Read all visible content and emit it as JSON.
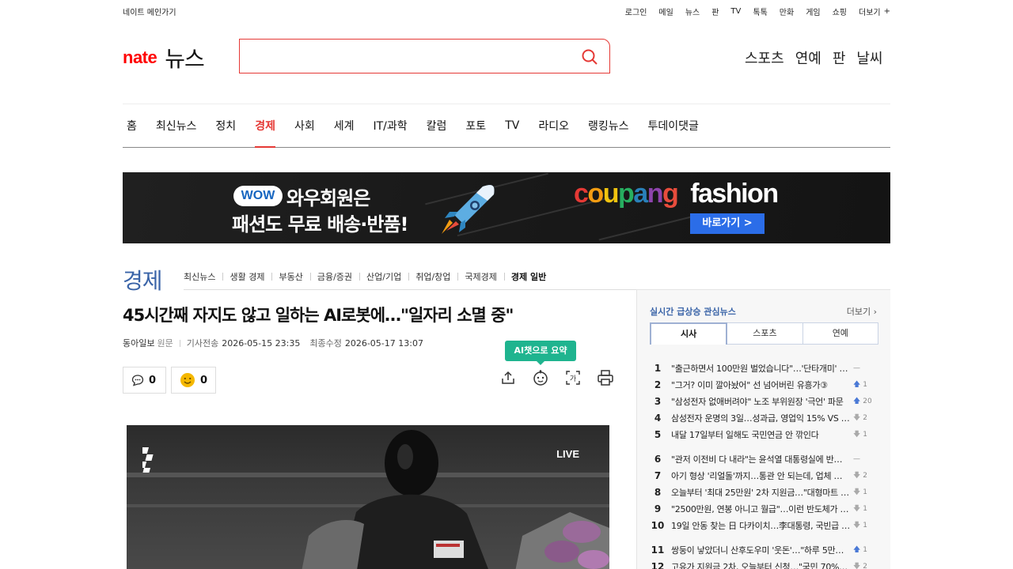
{
  "topbar": {
    "home_link": "네이트 메인가기",
    "links": [
      "로그인",
      "메일",
      "뉴스",
      "판",
      "TV",
      "톡톡",
      "만화",
      "게임",
      "쇼핑",
      "더보기"
    ],
    "more_plus": "+"
  },
  "header": {
    "logo_brand": "nate",
    "logo_section": "뉴스",
    "search_placeholder": "",
    "quick_links": [
      "스포츠",
      "연예",
      "판",
      "날씨"
    ]
  },
  "gnb": {
    "items": [
      "홈",
      "최신뉴스",
      "정치",
      "경제",
      "사회",
      "세계",
      "IT/과학",
      "칼럼",
      "포토",
      "TV",
      "라디오",
      "랭킹뉴스",
      "투데이댓글"
    ],
    "active": "경제"
  },
  "banner": {
    "badge": "WOW",
    "line1": "와우회원은",
    "line2": "패션도 무료 배송·반품!",
    "brand_coupang": "coupang",
    "brand_fashion": "fashion",
    "cta": "바로가기 >",
    "colors": {
      "c": "#e53935",
      "o": "#f39c12",
      "u": "#f1c40f",
      "p": "#27ae60",
      "a": "#2980b9",
      "n": "#8e44ad",
      "g": "#e74c3c"
    }
  },
  "section": {
    "title": "경제",
    "subnav": [
      "최신뉴스",
      "생활 경제",
      "부동산",
      "금융/증권",
      "산업/기업",
      "취업/창업",
      "국제경제",
      "경제 일반"
    ],
    "subnav_active": "경제 일반"
  },
  "article": {
    "headline": "45시간째 자지도 않고 일하는 AI로봇에…\"일자리 소멸 중\"",
    "press": "동아일보",
    "original": "원문",
    "sent_label": "기사전송",
    "sent_time": "2026-05-15 23:35",
    "updated_label": "최종수정",
    "updated_time": "2026-05-17 13:07",
    "comment_count": "0",
    "reaction_count": "0",
    "ai_tip_prefix": "AI",
    "ai_tip_rest": "챗으로 요약",
    "video_live": "LIVE"
  },
  "rail": {
    "title": "실시간 급상승 관심뉴스",
    "more": "더보기",
    "tabs": [
      "시사",
      "스포츠",
      "연예"
    ],
    "active_tab": "시사",
    "items": [
      {
        "rank": "1",
        "title": "\"출근하면서 100만원 벌었습니다\"…'단타개미' 역대급 …",
        "dir": "flat",
        "delta": ""
      },
      {
        "rank": "2",
        "title": "\"그거? 이미 깔아놨어\" 선 넘어버린 유흥가③",
        "dir": "up",
        "delta": "1"
      },
      {
        "rank": "3",
        "title": "\"삼성전자 없애버려야\" 노조 부위원장 '극언' 파문",
        "dir": "up",
        "delta": "20"
      },
      {
        "rank": "4",
        "title": "삼성전자 운명의 3일…성과급, 영업익 15% VS 1…",
        "dir": "dn",
        "delta": "2"
      },
      {
        "rank": "5",
        "title": "내달 17일부터 일해도 국민연금 안 깎인다",
        "dir": "dn",
        "delta": "1"
      },
      {
        "rank": "6",
        "title": "\"관저 이전비 다 내라\"는 윤석열 대통령실에 반…",
        "dir": "flat",
        "delta": ""
      },
      {
        "rank": "7",
        "title": "아기 형상 '리얼돌'까지…통관 안 되는데, 업체 …",
        "dir": "dn",
        "delta": "2"
      },
      {
        "rank": "8",
        "title": "오늘부터 '최대 25만원' 2차 지원금…\"대형마트 …",
        "dir": "dn",
        "delta": "1"
      },
      {
        "rank": "9",
        "title": "\"2500만원, 연봉 아니고 월급\"…이런 반도체가 …",
        "dir": "dn",
        "delta": "1"
      },
      {
        "rank": "10",
        "title": "19일 안동 찾는 日 다카이치…李대통령, 국빈급 …",
        "dir": "dn",
        "delta": "1"
      },
      {
        "rank": "11",
        "title": "쌍둥이 낳았더니 산후도우미 '웃돈'…\"하루 5만…",
        "dir": "up",
        "delta": "1"
      },
      {
        "rank": "12",
        "title": "고유가 지원금 2차, 오늘부터 신청…\"국민 70%…",
        "dir": "dn",
        "delta": "2"
      }
    ]
  }
}
